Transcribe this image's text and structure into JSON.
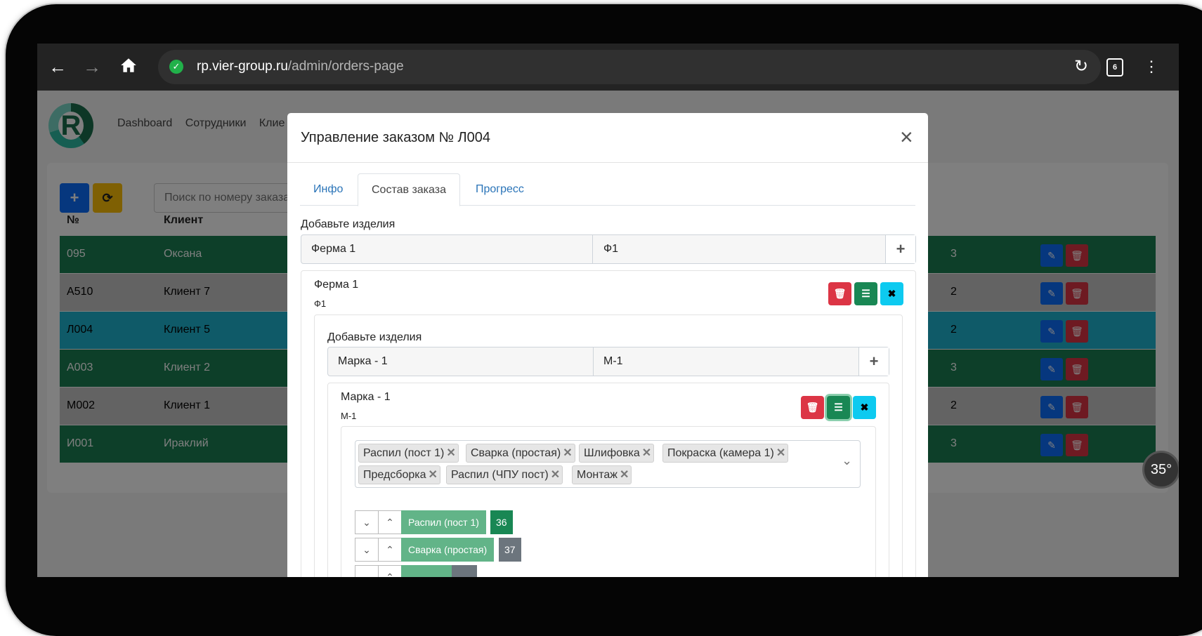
{
  "browser": {
    "url_host": "rp.vier-group.ru",
    "url_path": "/admin/orders-page",
    "tab_count": "6"
  },
  "nav": {
    "items": [
      "Dashboard",
      "Сотрудники",
      "Клие"
    ]
  },
  "toolbar": {
    "search_placeholder": "Поиск по номеру заказа"
  },
  "table": {
    "headers": [
      "№",
      "Клиент"
    ],
    "rows": [
      {
        "num": "095",
        "client": "Оксана",
        "extra": "3",
        "color": "#1a7f53"
      },
      {
        "num": "А510",
        "client": "Клиент 7",
        "extra": "2",
        "color": "#8c8c8c"
      },
      {
        "num": "Л004",
        "client": "Клиент 5",
        "extra": "2",
        "color": "#0f8fa3"
      },
      {
        "num": "А003",
        "client": "Клиент 2",
        "extra": "3",
        "color": "#1a7f53"
      },
      {
        "num": "М002",
        "client": "Клиент 1",
        "extra": "2",
        "color": "#8c8c8c"
      },
      {
        "num": "И001",
        "client": "Ираклий",
        "extra": "3",
        "color": "#1a7f53"
      }
    ]
  },
  "rotation_badge": "35°",
  "modal": {
    "title": "Управление заказом № Л004",
    "tabs": [
      "Инфо",
      "Состав заказа",
      "Прогресс"
    ],
    "active_tab": "Состав заказа",
    "add_label": "Добавьте изделия",
    "product_input": {
      "name": "Ферма 1",
      "code": "Ф1"
    },
    "product": {
      "name": "Ферма 1",
      "code": "Ф1",
      "add_label": "Добавьте изделия",
      "mark_input": {
        "name": "Марка - 1",
        "code": "М-1"
      },
      "mark": {
        "name": "Марка - 1",
        "code": "М-1",
        "operations": [
          "Распил (пост 1)",
          "Сварка (простая)",
          "Шлифовка",
          "Покраска (камера 1)",
          "Предсборка",
          "Распил (ЧПУ пост)",
          "Монтаж"
        ],
        "steps": [
          {
            "label": "Распил (пост 1)",
            "number": "36"
          },
          {
            "label": "Сварка (простая)",
            "number": "37"
          }
        ]
      }
    }
  },
  "colors": {
    "primary": "#0d6efd",
    "warning": "#ffc107",
    "danger": "#dc3545",
    "success": "#198754",
    "info": "#0dcaf0",
    "link": "#2a74b8"
  }
}
